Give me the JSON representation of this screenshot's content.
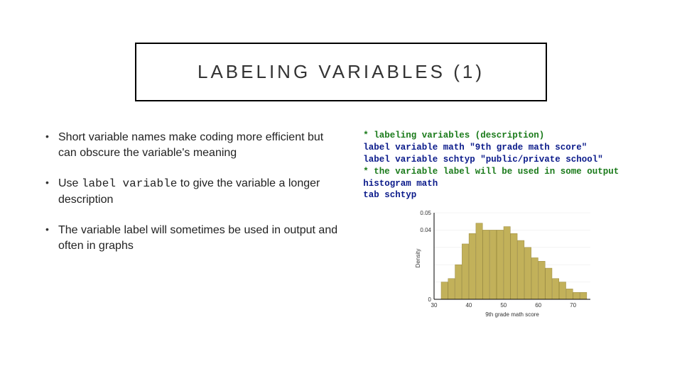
{
  "title": "LABELING VARIABLES (1)",
  "bullets": {
    "b1": "Short variable names make coding more efficient but can obscure the variable's meaning",
    "b2_prefix": "Use ",
    "b2_code": "label variable",
    "b2_suffix": " to give the variable a longer description",
    "b3": "The variable label will sometimes be used in output and often in graphs"
  },
  "code": {
    "l1": "* labeling variables (description)",
    "l2": "label variable math \"9th grade math score\"",
    "l3": "label variable schtyp \"public/private school\"",
    "l4": "* the variable label will be used in some output",
    "l5": "histogram math",
    "l6": "tab schtyp"
  },
  "chart_data": {
    "type": "hist",
    "title": "",
    "xlabel": "9th grade math score",
    "ylabel": "Density",
    "xlim": [
      30,
      75
    ],
    "ylim": [
      0,
      0.05
    ],
    "xticks": [
      30,
      40,
      50,
      60,
      70
    ],
    "yticks": [
      0,
      0.01,
      0.02,
      0.03,
      0.04,
      0.05
    ],
    "bins": [
      {
        "x": 33,
        "h": 0.01
      },
      {
        "x": 35,
        "h": 0.012
      },
      {
        "x": 37,
        "h": 0.02
      },
      {
        "x": 39,
        "h": 0.032
      },
      {
        "x": 41,
        "h": 0.038
      },
      {
        "x": 43,
        "h": 0.044
      },
      {
        "x": 45,
        "h": 0.04
      },
      {
        "x": 47,
        "h": 0.04
      },
      {
        "x": 49,
        "h": 0.04
      },
      {
        "x": 51,
        "h": 0.042
      },
      {
        "x": 53,
        "h": 0.038
      },
      {
        "x": 55,
        "h": 0.034
      },
      {
        "x": 57,
        "h": 0.03
      },
      {
        "x": 59,
        "h": 0.024
      },
      {
        "x": 61,
        "h": 0.022
      },
      {
        "x": 63,
        "h": 0.018
      },
      {
        "x": 65,
        "h": 0.012
      },
      {
        "x": 67,
        "h": 0.01
      },
      {
        "x": 69,
        "h": 0.006
      },
      {
        "x": 71,
        "h": 0.004
      },
      {
        "x": 73,
        "h": 0.004
      }
    ]
  }
}
